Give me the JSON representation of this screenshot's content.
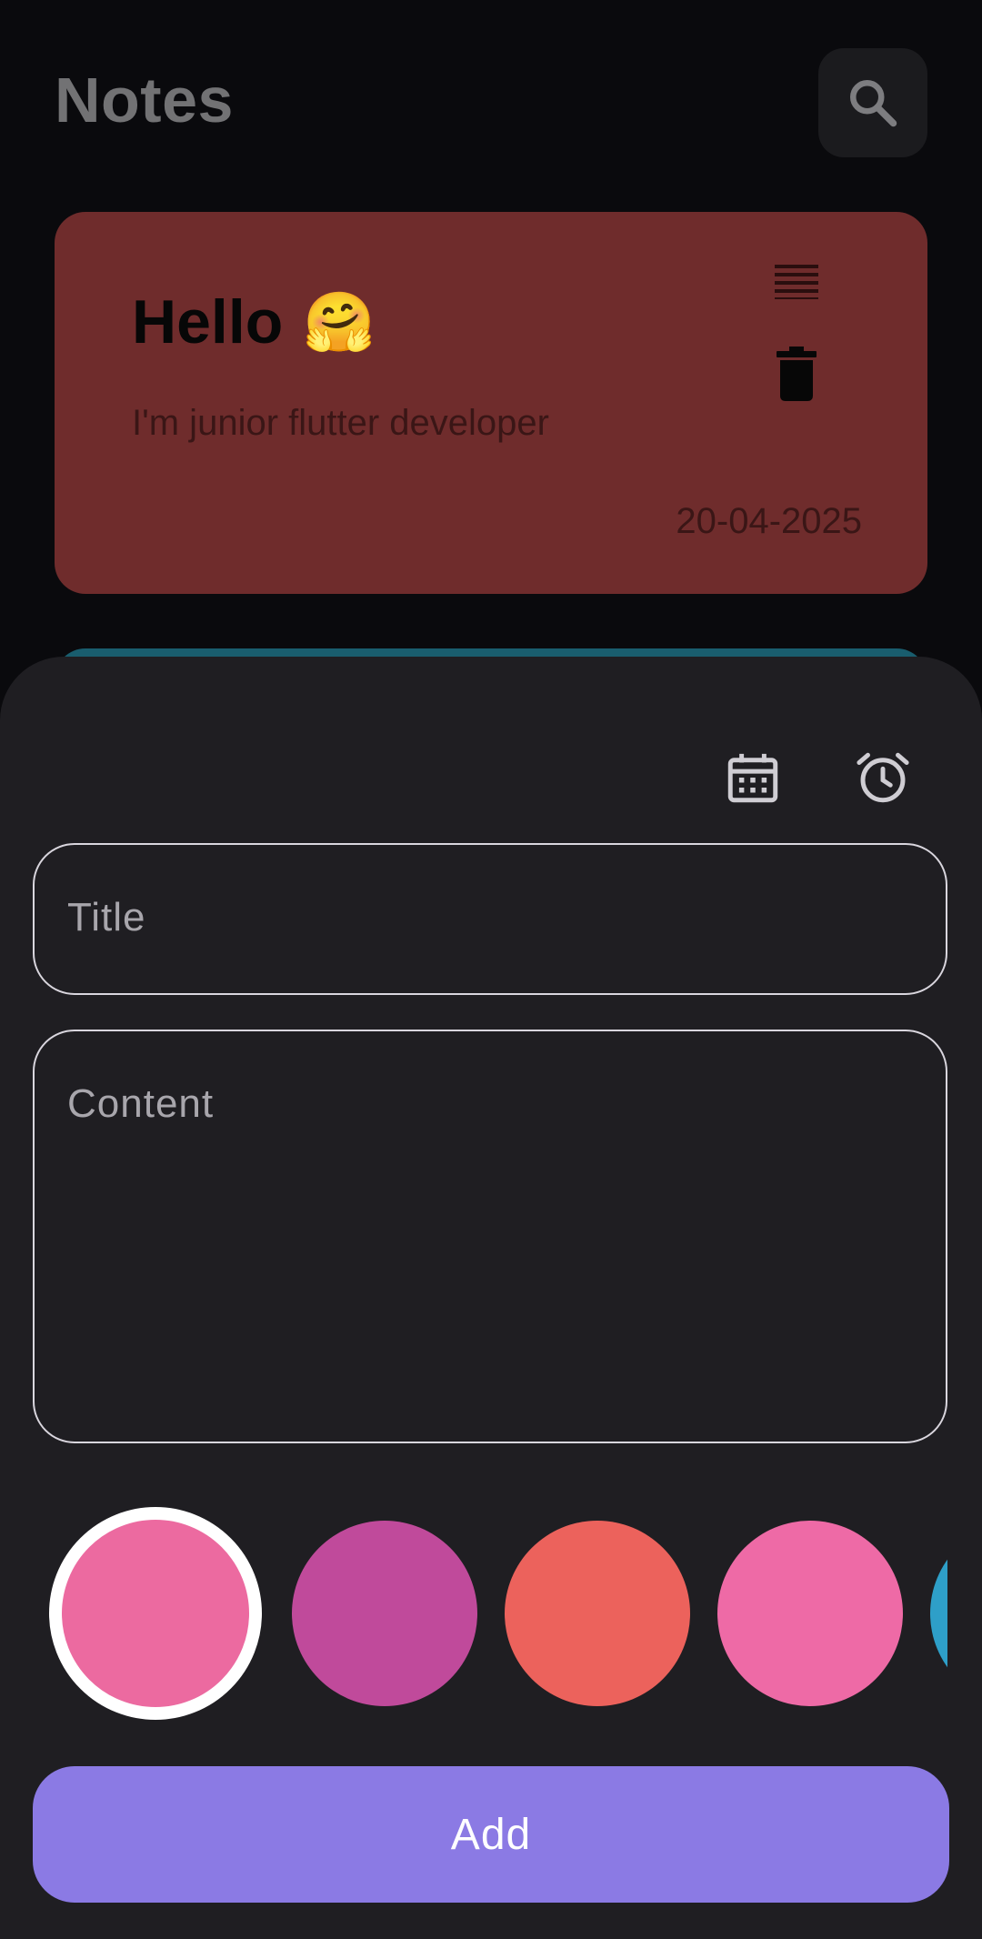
{
  "header": {
    "title": "Notes"
  },
  "note": {
    "title": "Hello",
    "emoji": "🤗",
    "content": "I'm junior flutter developer",
    "date": "20-04-2025",
    "color": "#6f2c2c"
  },
  "next_note": {
    "color": "#195d6e"
  },
  "sheet": {
    "title_placeholder": "Title",
    "content_placeholder": "Content",
    "add_label": "Add",
    "colors": [
      "#ec6aa0",
      "#c04a9b",
      "#ec625c",
      "#ee6aa6",
      "#2e9fc8"
    ],
    "selected_color_index": 0,
    "accent": "#8b7ae4"
  }
}
